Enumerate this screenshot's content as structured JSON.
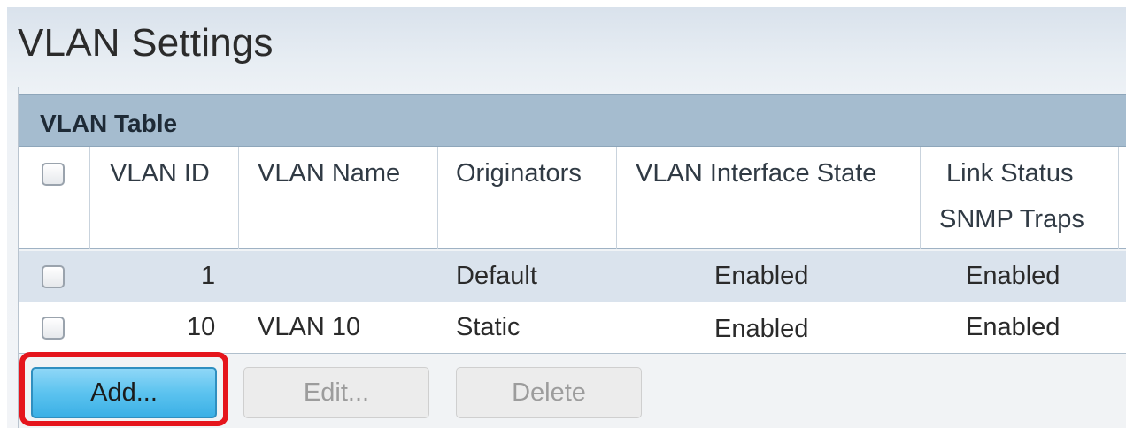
{
  "page": {
    "title": "VLAN Settings"
  },
  "panel": {
    "title": "VLAN Table"
  },
  "columns": {
    "vlan_id": "VLAN ID",
    "vlan_name": "VLAN Name",
    "originators": "Originators",
    "interface_state": "VLAN Interface State",
    "link_status_1": "Link Status",
    "link_status_2": "SNMP Traps"
  },
  "rows": [
    {
      "vlan_id": "1",
      "vlan_name": "",
      "originators": "Default",
      "interface_state": "Enabled",
      "link_status": "Enabled",
      "selected": false
    },
    {
      "vlan_id": "10",
      "vlan_name": "VLAN 10",
      "originators": "Static",
      "interface_state": "Enabled",
      "link_status": "Enabled",
      "selected": false
    }
  ],
  "buttons": {
    "add": "Add...",
    "edit": "Edit...",
    "delete": "Delete"
  },
  "colors": {
    "header_bg": "#a5bccf",
    "add_button": "#5cc3ef",
    "highlight": "#e5151c",
    "row_alt": "#dae3ed"
  }
}
